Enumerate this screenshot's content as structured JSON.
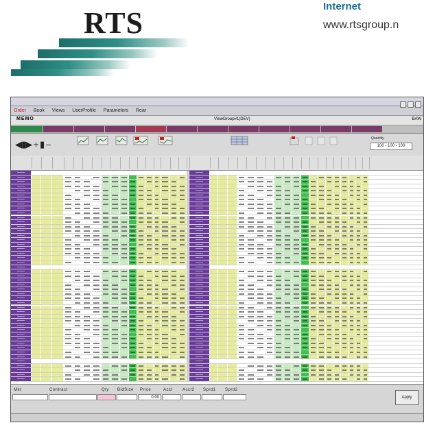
{
  "brochure": {
    "logo_text": "RTS",
    "internet_label": "Internet",
    "internet_url": "www.rtsgroup.n"
  },
  "window": {
    "title": "",
    "menu": [
      "Order",
      "Book",
      "Views",
      "UserProfile",
      "Parameters",
      "Rear"
    ],
    "info_left": "MEMO",
    "info_center": "ViewGroup#1(DEV)",
    "info_right": "BAW",
    "tabs": [
      {
        "color": "#2d8a4a"
      },
      {
        "color": "#7a3a66"
      },
      {
        "color": "#7a3a66"
      },
      {
        "color": "#7a3a66"
      },
      {
        "color": "#a13a52"
      },
      {
        "color": "#7a3a66"
      },
      {
        "color": "#7a3a66"
      },
      {
        "color": "#7a3a66"
      },
      {
        "color": "#7a3a66"
      },
      {
        "color": "#7a3a66"
      },
      {
        "color": "#7a3a66"
      },
      {
        "color": "#7a3a66"
      }
    ],
    "toolbar": {
      "qty_label": "Quantity",
      "qty_value": "100 - 100 - 100"
    },
    "entry": {
      "labels": [
        "Mkt",
        "Contract",
        "Qty",
        "BidSize",
        "Price",
        "Acct",
        "Acct2",
        "Sprd1",
        "Sprd2"
      ],
      "price_value": "0.00",
      "apply": "Apply"
    },
    "colors": {
      "purple": "#6a3a9a",
      "green": "#3fbf4e",
      "yellow": "#e6ec9a",
      "mint": "#c9ecc4",
      "lime": "#d8f0a8"
    }
  }
}
